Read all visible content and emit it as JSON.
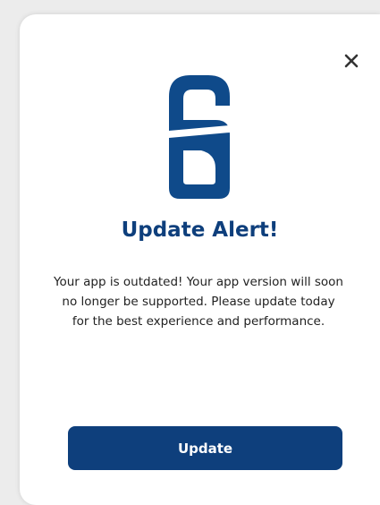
{
  "dialog": {
    "close_icon": "close-icon",
    "logo_icon": "shield-s-logo-icon",
    "title": "Update Alert!",
    "message": "Your app is outdated! Your app version will soon no longer be supported. Please update today for the best experience and performance.",
    "update_label": "Update"
  },
  "colors": {
    "brand": "#0e3f7c",
    "logo_blue": "#0f4a8a",
    "close": "#333333",
    "background": "#ffffff"
  }
}
